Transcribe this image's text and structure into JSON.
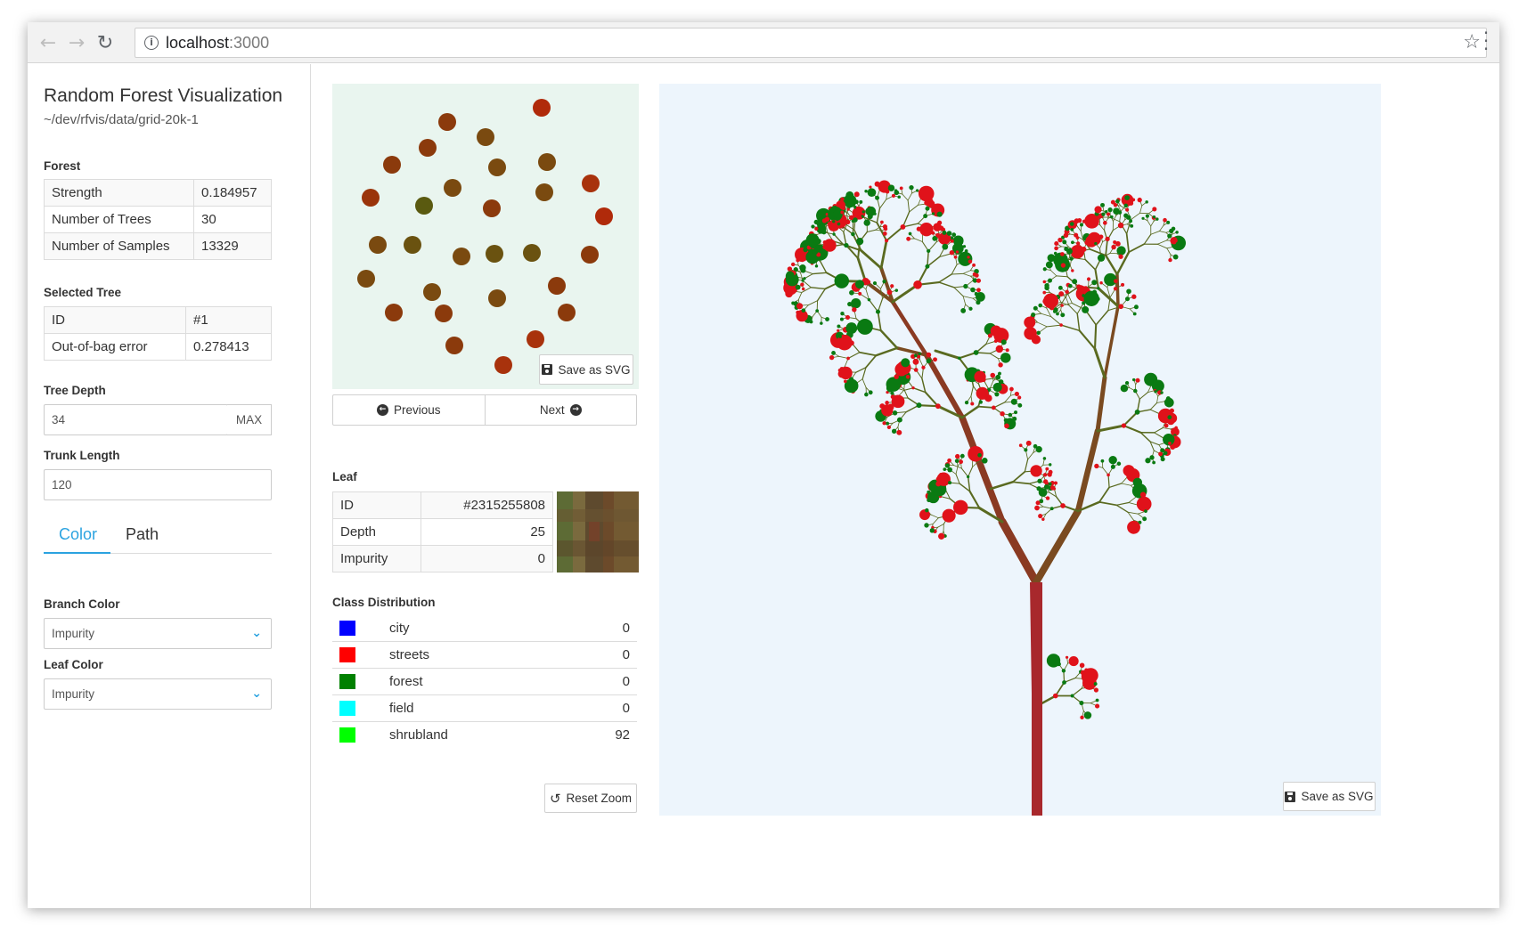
{
  "browser": {
    "url_host": "localhost",
    "url_port": ":3000"
  },
  "sidebar": {
    "title": "Random Forest Visualization",
    "path": "~/dev/rfvis/data/grid-20k-1",
    "forest_label": "Forest",
    "forest": [
      {
        "key": "Strength",
        "value": "0.184957"
      },
      {
        "key": "Number of Trees",
        "value": "30"
      },
      {
        "key": "Number of Samples",
        "value": "13329"
      }
    ],
    "selected_tree_label": "Selected Tree",
    "selected_tree": [
      {
        "key": "ID",
        "value": "#1"
      },
      {
        "key": "Out-of-bag error",
        "value": "0.278413"
      }
    ],
    "tree_depth_label": "Tree Depth",
    "tree_depth_value": "34",
    "tree_depth_addon": "MAX",
    "trunk_length_label": "Trunk Length",
    "trunk_length_value": "120",
    "tabs": [
      "Color",
      "Path"
    ],
    "branch_color_label": "Branch Color",
    "branch_color_value": "Impurity",
    "leaf_color_label": "Leaf Color",
    "leaf_color_value": "Impurity"
  },
  "middle": {
    "save_svg_label": "Save as SVG",
    "previous_label": "Previous",
    "next_label": "Next",
    "leaf_label": "Leaf",
    "leaf": [
      {
        "key": "ID",
        "value": "#2315255808"
      },
      {
        "key": "Depth",
        "value": "25"
      },
      {
        "key": "Impurity",
        "value": "0"
      }
    ],
    "class_distribution_label": "Class Distribution",
    "classes": [
      {
        "name": "city",
        "value": "0",
        "color": "#0000ff"
      },
      {
        "name": "streets",
        "value": "0",
        "color": "#ff0000"
      },
      {
        "name": "forest",
        "value": "0",
        "color": "#008000"
      },
      {
        "name": "field",
        "value": "0",
        "color": "#00ffff"
      },
      {
        "name": "shrubland",
        "value": "92",
        "color": "#00ff00"
      }
    ],
    "reset_zoom_label": "Reset Zoom"
  },
  "tree_panel": {
    "save_svg_label": "Save as SVG"
  }
}
